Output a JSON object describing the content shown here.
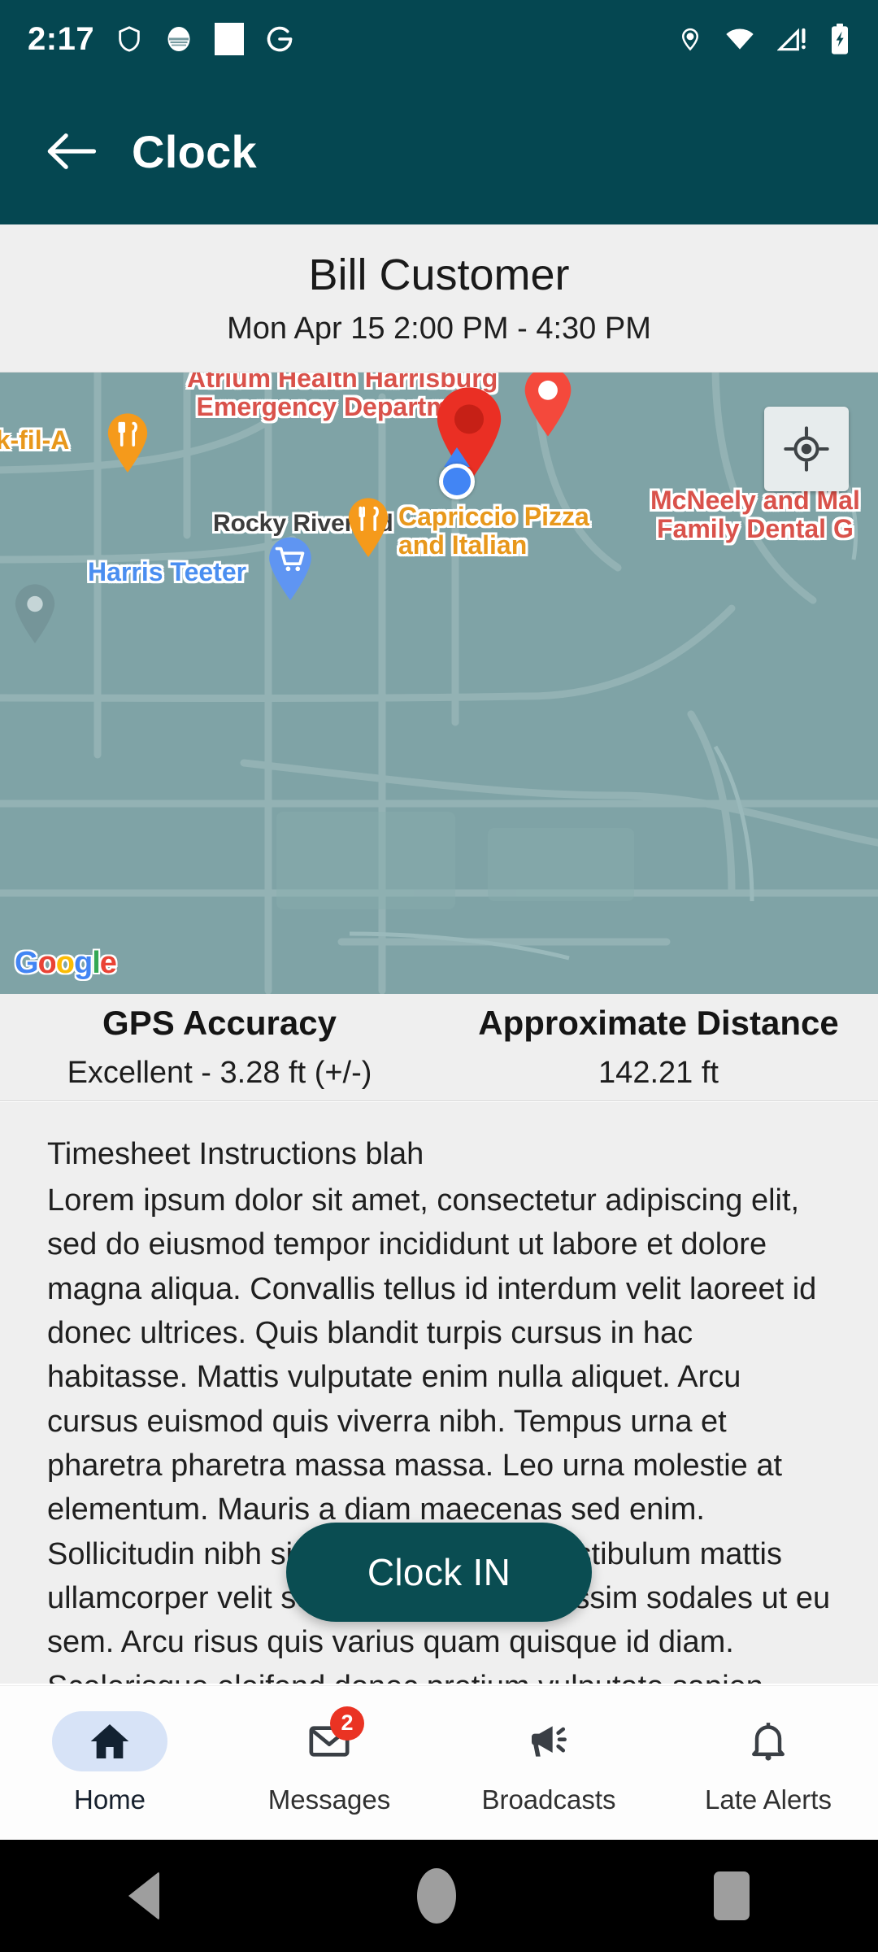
{
  "status_bar": {
    "time": "2:17",
    "left_icons": [
      "shield-icon",
      "mask-icon",
      "square-icon",
      "google-g-icon"
    ],
    "right_icons": [
      "location-icon",
      "wifi-icon",
      "cellular-warning-icon",
      "battery-charging-icon"
    ]
  },
  "app_bar": {
    "back_label": "back-arrow",
    "title": "Clock"
  },
  "header": {
    "customer_name": "Bill Customer",
    "appointment_time": "Mon Apr 15 2:00 PM - 4:30 PM"
  },
  "map": {
    "provider_logo": "Google",
    "my_location_button": "my-location",
    "labels": [
      {
        "text": "Atrium Health Harrisburg\nEmergency Department",
        "color": "#d9524b"
      },
      {
        "text": "McNeely and Mal\nFamily Dental G",
        "color": "#d9524b"
      },
      {
        "text": "Rocky River Rd",
        "color": "#3c3c3c"
      },
      {
        "text": "ick-fil-A",
        "color": "#e8981c"
      },
      {
        "text": "Capriccio Pizza\nand Italian",
        "color": "#e8981c"
      },
      {
        "text": "Harris Teeter",
        "color": "#4a8ef0"
      }
    ],
    "destination_pin_color": "#ea2f24",
    "hospital_pin_color": "#f4493c",
    "user_location_color": "#4285f4"
  },
  "stats": {
    "gps": {
      "title": "GPS Accuracy",
      "value": "Excellent - 3.28 ft (+/-)"
    },
    "distance": {
      "title": "Approximate Distance",
      "value": "142.21 ft"
    }
  },
  "instructions": {
    "title": "Timesheet Instructions blah",
    "text": "Lorem ipsum dolor sit amet, consectetur adipiscing elit, sed do eiusmod tempor incididunt ut labore et dolore magna aliqua. Convallis tellus id interdum velit laoreet id donec ultrices. Quis blandit turpis cursus in hac habitasse. Mattis vulputate enim nulla aliquet. Arcu cursus euismod quis viverra nibh. Tempus urna et pharetra pharetra massa massa. Leo urna molestie at elementum. Mauris a diam maecenas sed enim. Sollicitudin nibh sit amet commodo. Vestibulum mattis ullamcorper velit sed ullamcorper dignissim sodales ut eu sem. Arcu risus quis varius quam quisque id diam. Scelerisque eleifend donec pretium vulputate sapien"
  },
  "primary_action": {
    "label": "Clock IN",
    "color": "#0a4d52"
  },
  "bottom_nav": {
    "items": [
      {
        "label": "Home",
        "icon": "home-icon",
        "active": true,
        "badge": ""
      },
      {
        "label": "Messages",
        "icon": "mail-icon",
        "active": false,
        "badge": "2"
      },
      {
        "label": "Broadcasts",
        "icon": "megaphone-icon",
        "active": false,
        "badge": ""
      },
      {
        "label": "Late Alerts",
        "icon": "bell-icon",
        "active": false,
        "badge": ""
      }
    ]
  },
  "system_nav": {
    "back": "back-triangle",
    "home": "home-circle",
    "recents": "recents-square"
  },
  "theme": {
    "primary": "#054751",
    "accent": "#0a4d52",
    "surface": "#efefef",
    "badge": "#ea3323"
  }
}
